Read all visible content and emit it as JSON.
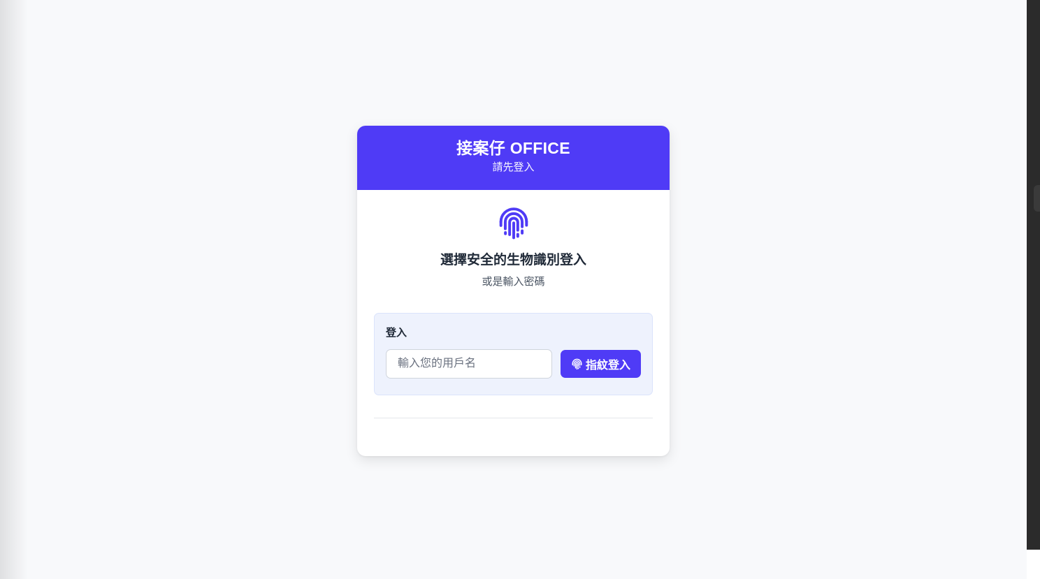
{
  "header": {
    "title": "接案仔 OFFICE",
    "subtitle": "請先登入"
  },
  "prompt": {
    "headline": "選擇安全的生物識別登入",
    "subline": "或是輸入密碼"
  },
  "login": {
    "label": "登入",
    "username_placeholder": "輸入您的用戶名",
    "username_value": "",
    "fingerprint_button_label": "指紋登入"
  },
  "icons": {
    "big": "fingerprint-icon",
    "button": "fingerprint-icon"
  },
  "colors": {
    "accent": "#4f3bf6",
    "page_background": "#f8f9fb",
    "login_box_background": "#eef2fd",
    "headline_text": "#1f2937",
    "muted_text": "#4b5563"
  }
}
